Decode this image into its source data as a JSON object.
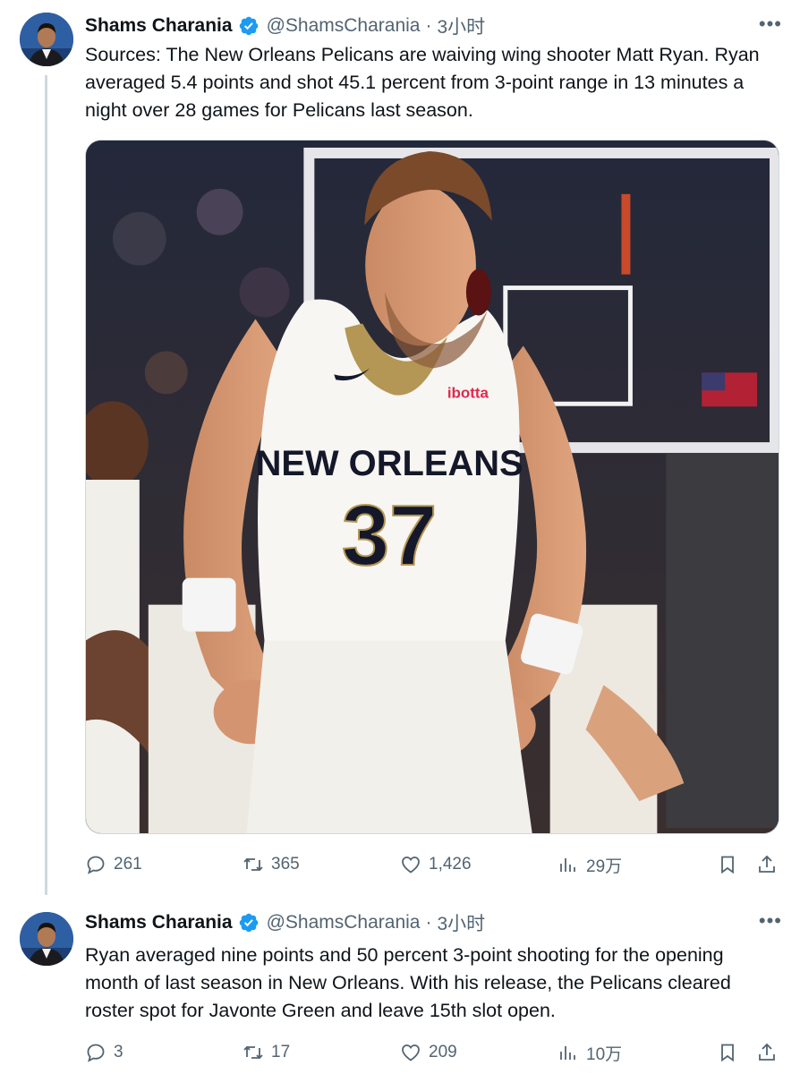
{
  "tweets": [
    {
      "author": {
        "name": "Shams Charania",
        "handle": "@ShamsCharania",
        "time": "3小时"
      },
      "text": "Sources: The New Orleans Pelicans are waiving wing shooter Matt Ryan. Ryan averaged 5.4 points and shot 45.1 percent from 3-point range in 13 minutes a night over 28 games for Pelicans last season.",
      "media": {
        "jersey_team": "NEW ORLEANS",
        "jersey_number": "37",
        "jersey_sponsor": "ibotta"
      },
      "stats": {
        "replies": "261",
        "retweets": "365",
        "likes": "1,426",
        "views": "29万"
      }
    },
    {
      "author": {
        "name": "Shams Charania",
        "handle": "@ShamsCharania",
        "time": "3小时"
      },
      "text": "Ryan averaged nine points and 50 percent 3-point shooting for the opening month of last season in New Orleans. With his release, the Pelicans cleared roster spot for Javonte Green and leave 15th slot open.",
      "stats": {
        "replies": "3",
        "retweets": "17",
        "likes": "209",
        "views": "10万"
      }
    }
  ],
  "ui": {
    "separator": "·",
    "more": "•••"
  },
  "colors": {
    "verified": "#1d9bf0",
    "muted": "#536471",
    "text": "#0f1419",
    "line": "#cfd9de"
  },
  "icons": [
    "reply-icon",
    "retweet-icon",
    "like-icon",
    "views-icon",
    "bookmark-icon",
    "share-icon",
    "verified-badge-icon",
    "more-icon"
  ]
}
